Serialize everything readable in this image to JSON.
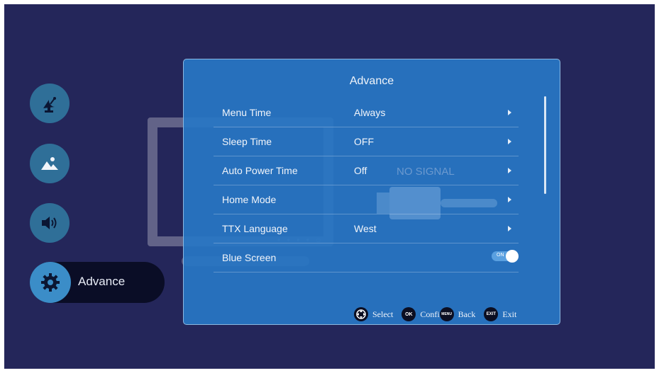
{
  "nav": {
    "items": [
      {
        "icon": "satellite-dish-icon"
      },
      {
        "icon": "picture-mountains-icon"
      },
      {
        "icon": "speaker-sound-icon"
      },
      {
        "icon": "gear-icon",
        "label": "Advance"
      }
    ]
  },
  "background": {
    "status_text": "NO SIGNAL"
  },
  "panel": {
    "title": "Advance",
    "rows": [
      {
        "label": "Menu Time",
        "value": "Always"
      },
      {
        "label": "Sleep Time",
        "value": "OFF"
      },
      {
        "label": "Auto Power Time",
        "value": "Off"
      },
      {
        "label": "Home Mode",
        "value": ""
      },
      {
        "label": "TTX Language",
        "value": "West"
      },
      {
        "label": "Blue Screen",
        "toggle": "ON"
      }
    ]
  },
  "footer": {
    "select_label": "Select",
    "ok_icon": "OK",
    "confirm_label": "Confi",
    "menu_icon": "MENU",
    "back_label": "Back",
    "exit_icon": "EXIT",
    "exit_label": "Exit"
  },
  "colors": {
    "screen_bg": "#24265a",
    "panel_bg": "#2876c4",
    "nav_icon_bg": "#2f6f98",
    "nav_active_bg": "#0a0d26"
  }
}
